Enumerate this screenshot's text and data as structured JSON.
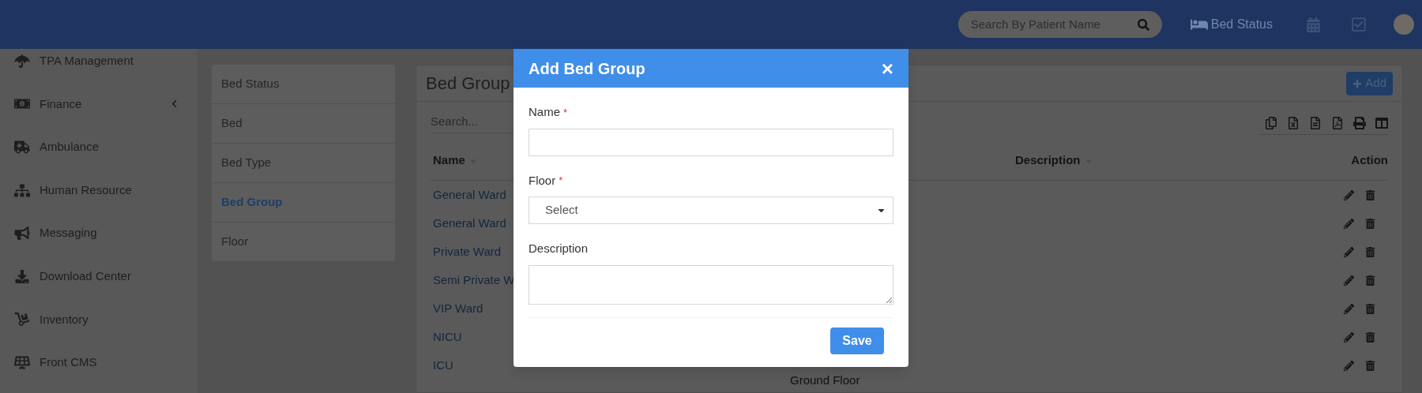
{
  "topbar": {
    "search": {
      "placeholder": "Search By Patient Name"
    },
    "bed_status": "Bed Status"
  },
  "sidebar": {
    "items": [
      {
        "label": "TPA Management",
        "expandable": false
      },
      {
        "label": "Finance",
        "expandable": true
      },
      {
        "label": "Ambulance",
        "expandable": false
      },
      {
        "label": "Human Resource",
        "expandable": false
      },
      {
        "label": "Messaging",
        "expandable": false
      },
      {
        "label": "Download Center",
        "expandable": false
      },
      {
        "label": "Inventory",
        "expandable": false
      },
      {
        "label": "Front CMS",
        "expandable": false
      }
    ]
  },
  "setup_menu": [
    {
      "label": "Bed Status",
      "selected": false
    },
    {
      "label": "Bed",
      "selected": false
    },
    {
      "label": "Bed Type",
      "selected": false
    },
    {
      "label": "Bed Group",
      "selected": true
    },
    {
      "label": "Floor",
      "selected": false
    }
  ],
  "card": {
    "title": "Bed Group",
    "add_button": "Add",
    "search": {
      "placeholder": "Search..."
    },
    "table": {
      "columns": [
        "Name",
        "Description",
        "Action"
      ],
      "rows": [
        {
          "name": "General Ward"
        },
        {
          "name": "General Ward"
        },
        {
          "name": "Private Ward"
        },
        {
          "name": "Semi Private W"
        },
        {
          "name": "VIP Ward"
        },
        {
          "name": "NICU"
        },
        {
          "name": "ICU",
          "floor": "Ground Floor"
        }
      ]
    }
  },
  "modal": {
    "title": "Add Bed Group",
    "close": "×",
    "fields": [
      {
        "kind": "text",
        "label": "Name",
        "required": true
      },
      {
        "kind": "select",
        "label": "Floor",
        "required": true,
        "value": "Select"
      },
      {
        "kind": "textarea",
        "label": "Description",
        "required": false
      }
    ],
    "required_mark": "*",
    "save_button": "Save"
  }
}
